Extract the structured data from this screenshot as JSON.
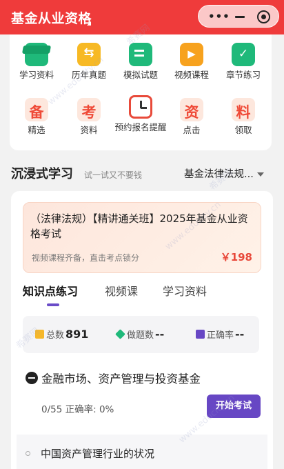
{
  "header": {
    "title": "基金从业资格",
    "menu_dots": "•••"
  },
  "grid": [
    {
      "label": "学习资料",
      "icon": "graduation-cap-icon"
    },
    {
      "label": "历年真题",
      "icon": "exchange-doc-icon"
    },
    {
      "label": "模拟试题",
      "icon": "mock-test-icon"
    },
    {
      "label": "视频课程",
      "icon": "video-icon"
    },
    {
      "label": "章节练习",
      "icon": "checklist-icon"
    },
    {
      "label": "精选",
      "icon_char": "备"
    },
    {
      "label": "资料",
      "icon_char": "考"
    },
    {
      "label": "预约报名提醒",
      "icon": "alarm-clock-icon"
    },
    {
      "label": "点击",
      "icon_char": "资"
    },
    {
      "label": "领取",
      "icon_char": "料"
    }
  ],
  "section": {
    "title": "沉浸式学习",
    "subtitle": "试一试又不要钱",
    "selector": "基金法律法规..."
  },
  "course": {
    "name": "（法律法规）【精讲通关班】2025年基金从业资格考试",
    "desc": "视频课程齐备，直击考点锁分",
    "price": "￥198"
  },
  "tabs": [
    "知识点练习",
    "视频课",
    "学习资料"
  ],
  "stats": {
    "total_label": "总数",
    "total_value": "891",
    "done_label": "做题数",
    "done_value": "--",
    "accuracy_label": "正确率",
    "accuracy_value": "--"
  },
  "chapter": {
    "title": "金融市场、资产管理与投资基金",
    "progress": "0/55  正确率: 0%",
    "button": "开始考试"
  },
  "sub_item": {
    "title": "中国资产管理行业的状况"
  },
  "watermark": {
    "text1": "希赛网",
    "text2": "www.educity.cn"
  },
  "colors": {
    "brand": "#ef3b3b",
    "accent": "#6747c4",
    "price": "#e8483a"
  }
}
